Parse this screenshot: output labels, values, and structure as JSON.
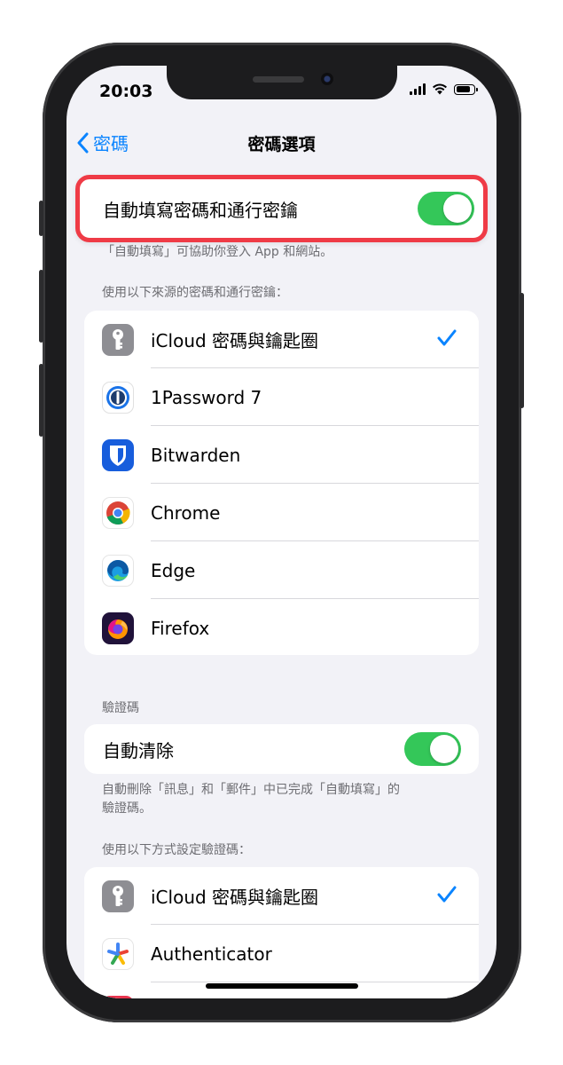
{
  "status": {
    "time": "20:03"
  },
  "nav": {
    "back_label": "密碼",
    "title": "密碼選項"
  },
  "autofill": {
    "label": "自動填寫密碼和通行密鑰",
    "enabled": true,
    "caption": "「自動填寫」可協助你登入 App 和網站。"
  },
  "sources": {
    "header": "使用以下來源的密碼和通行密鑰：",
    "items": [
      {
        "label": "iCloud 密碼與鑰匙圈",
        "icon": "keychain-icon",
        "checked": true
      },
      {
        "label": "1Password 7",
        "icon": "1password-icon",
        "checked": false
      },
      {
        "label": "Bitwarden",
        "icon": "bitwarden-icon",
        "checked": false
      },
      {
        "label": "Chrome",
        "icon": "chrome-icon",
        "checked": false
      },
      {
        "label": "Edge",
        "icon": "edge-icon",
        "checked": false
      },
      {
        "label": "Firefox",
        "icon": "firefox-icon",
        "checked": false
      }
    ]
  },
  "verification": {
    "header": "驗證碼",
    "auto_clear_label": "自動清除",
    "auto_clear_enabled": true,
    "caption_line1": "自動刪除「訊息」和「郵件」中已完成「自動填寫」的",
    "caption_line2": "驗證碼。",
    "methods_header": "使用以下方式設定驗證碼：",
    "methods": [
      {
        "label": "iCloud 密碼與鑰匙圈",
        "icon": "keychain-icon",
        "checked": true
      },
      {
        "label": "Authenticator",
        "icon": "authenticator-icon",
        "checked": false
      }
    ]
  },
  "colors": {
    "accent": "#0a84ff",
    "toggle_on": "#34c759",
    "highlight": "#ef3b46"
  }
}
